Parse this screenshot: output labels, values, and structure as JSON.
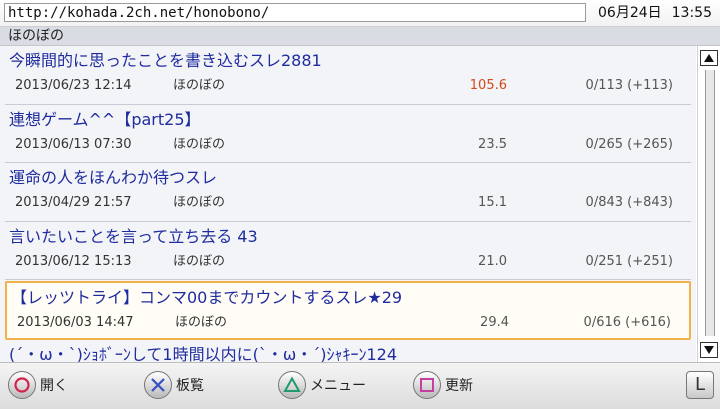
{
  "address_bar": {
    "url": "http://kohada.2ch.net/honobono/"
  },
  "clock": {
    "date": "06月24日",
    "time": "13:55"
  },
  "board": {
    "title": "ほのぼの"
  },
  "threads": [
    {
      "title": "今瞬間的に思ったことを書き込むスレ2881",
      "date": "2013/06/23 12:14",
      "board": "ほのぼの",
      "speed": "105.6",
      "count": "0/113 (+113)"
    },
    {
      "title": "連想ゲーム^^【part25】",
      "date": "2013/06/13 07:30",
      "board": "ほのぼの",
      "speed": "23.5",
      "count": "0/265 (+265)"
    },
    {
      "title": "運命の人をほんわか待つスレ",
      "date": "2013/04/29 21:57",
      "board": "ほのぼの",
      "speed": "15.1",
      "count": "0/843 (+843)"
    },
    {
      "title": "言いたいことを言って立ち去る 43",
      "date": "2013/06/12 15:13",
      "board": "ほのぼの",
      "speed": "21.0",
      "count": "0/251 (+251)"
    },
    {
      "title": "【レッツトライ】コンマ00までカウントするスレ★29",
      "date": "2013/06/03 14:47",
      "board": "ほのぼの",
      "speed": "29.4",
      "count": "0/616 (+616)"
    },
    {
      "title": "(´・ω・`)ｼｮﾎﾞｰﾝして1時間以内に(`・ω・´)ｼｬｷｰﾝ124",
      "date": "",
      "board": "",
      "speed": "",
      "count": ""
    }
  ],
  "controls": {
    "circle_label": "開く",
    "cross_label": "板覧",
    "triangle_label": "メニュー",
    "square_label": "更新",
    "l_label": "L"
  },
  "colors": {
    "title": "#1f2c9e",
    "hot_speed": "#d24a17",
    "selection": "#f0b04a"
  }
}
